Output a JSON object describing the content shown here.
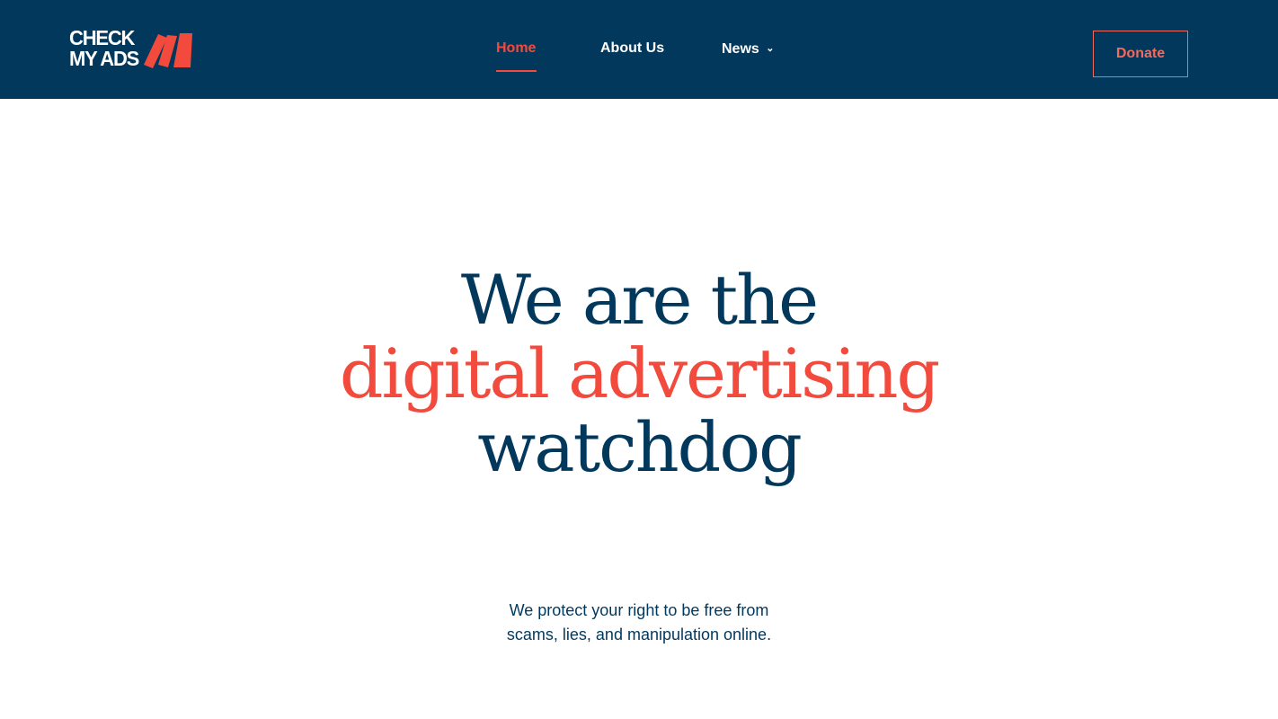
{
  "brand": {
    "logo_line1": "CHECK",
    "logo_line2": "MY ADS",
    "colors": {
      "navy": "#02385c",
      "accent": "#f24a3c",
      "donate": "#f26b5e",
      "white": "#ffffff"
    }
  },
  "nav": {
    "items": [
      {
        "label": "Home",
        "active": true
      },
      {
        "label": "About Us",
        "active": false
      },
      {
        "label": "News",
        "active": false,
        "icon": "chevron-down-icon"
      }
    ]
  },
  "header": {
    "donate_label": "Donate"
  },
  "hero": {
    "line1": "We are the",
    "line2": "digital advertising",
    "line3": "watchdog"
  },
  "intro": {
    "line1": "We protect your right to be free from",
    "line2": "scams, lies, and manipulation online."
  }
}
